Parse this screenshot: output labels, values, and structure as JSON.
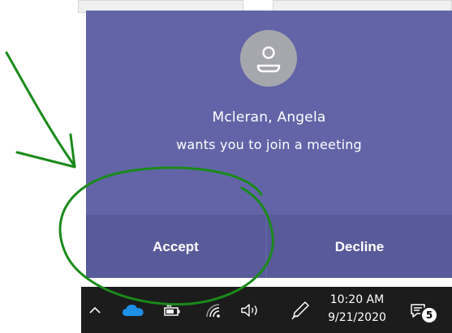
{
  "incoming_call": {
    "caller_name": "Mcleran, Angela",
    "message": "wants you to join a meeting",
    "accept_label": "Accept",
    "decline_label": "Decline",
    "avatar_icon": "person-icon"
  },
  "taskbar": {
    "time": "10:20 AM",
    "date": "9/21/2020",
    "notification_count": "5",
    "tray_icons": [
      "show-hidden-icons-chevron",
      "onedrive-cloud-icon",
      "battery-icon",
      "wifi-icon",
      "volume-icon",
      "pen-icon",
      "action-center-icon"
    ]
  },
  "colors": {
    "toast_background": "#6264a7",
    "button_background": "#585a99",
    "avatar_background": "#a6a6ad",
    "taskbar_background": "#1c1c1c",
    "onedrive_blue": "#1e90e8",
    "annotation_green": "#1a8a1a"
  }
}
